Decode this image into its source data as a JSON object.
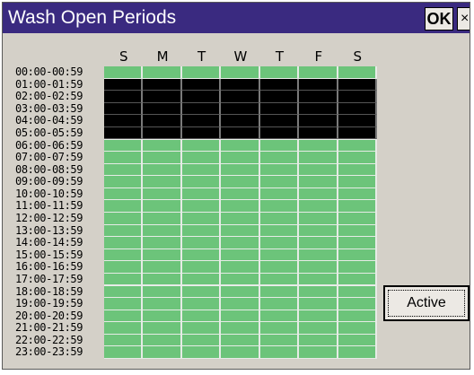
{
  "window": {
    "title": "Wash Open Periods",
    "ok_label": "OK",
    "close_label": "×"
  },
  "days": [
    "S",
    "M",
    "T",
    "W",
    "T",
    "F",
    "S"
  ],
  "hours": [
    "00:00-00:59",
    "01:00-01:59",
    "02:00-02:59",
    "03:00-03:59",
    "04:00-04:59",
    "05:00-05:59",
    "06:00-06:59",
    "07:00-07:59",
    "08:00-08:59",
    "09:00-09:59",
    "10:00-10:59",
    "11:00-11:59",
    "12:00-12:59",
    "13:00-13:59",
    "14:00-14:59",
    "15:00-15:59",
    "16:00-16:59",
    "17:00-17:59",
    "18:00-18:59",
    "19:00-19:59",
    "20:00-20:59",
    "21:00-21:59",
    "22:00-22:59",
    "23:00-23:59"
  ],
  "schedule": {
    "closed_hours": [
      1,
      2,
      3,
      4,
      5
    ],
    "open_color": "#6cc47a",
    "closed_color": "#000000"
  },
  "action": {
    "active_label": "Active"
  }
}
